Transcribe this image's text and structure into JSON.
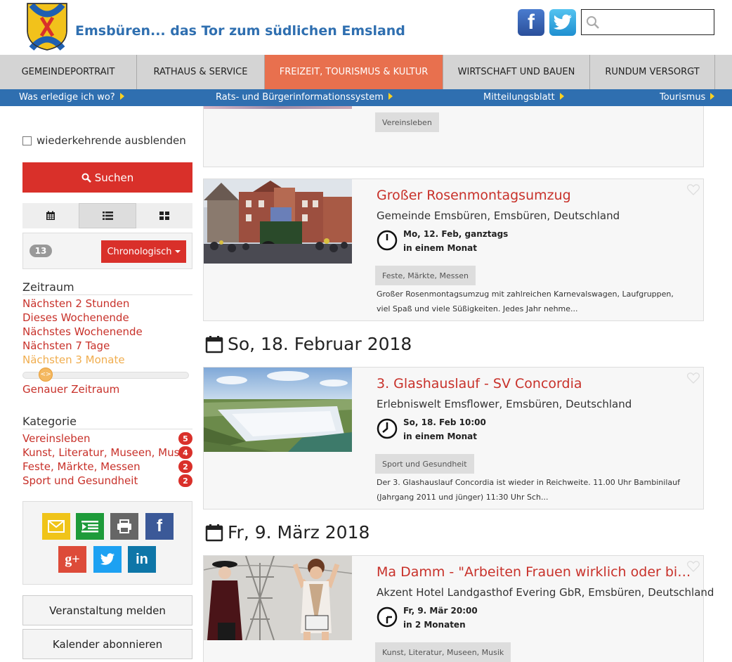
{
  "header": {
    "site_title": "Emsbüren... das Tor zum südlichen Emsland",
    "search_placeholder": ""
  },
  "main_nav": [
    "GEMEINDEPORTRAIT",
    "RATHAUS & SERVICE",
    "FREIZEIT, TOURISMUS & KULTUR",
    "WIRTSCHAFT UND BAUEN",
    "RUNDUM VERSORGT"
  ],
  "sub_nav": [
    "Was erledige ich wo?",
    "Rats- und Bürgerinformationssystem",
    "Mitteilungsblatt",
    "Tourismus"
  ],
  "sidebar": {
    "hide_recurring_label": "wiederkehrende ausblenden",
    "search_button": "Suchen",
    "result_count": "13",
    "sort_label": "Chronologisch",
    "timeframe_heading": "Zeitraum",
    "timeframe_links": [
      "Nächsten 2 Stunden",
      "Dieses Wochenende",
      "Nächstes Wochenende",
      "Nächsten 7 Tage",
      "Nächsten 3 Monate"
    ],
    "timeframe_active": "Nächsten 3 Monate",
    "exact_timeframe": "Genauer Zeitraum",
    "category_heading": "Kategorie",
    "categories": [
      {
        "name": "Vereinsleben",
        "count": "5"
      },
      {
        "name": "Kunst, Literatur, Museen, Musik",
        "count": "4"
      },
      {
        "name": "Feste, Märkte, Messen",
        "count": "2"
      },
      {
        "name": "Sport und Gesundheit",
        "count": "2"
      }
    ],
    "report_event": "Veranstaltung melden",
    "subscribe_calendar": "Kalender abonnieren"
  },
  "events": {
    "partial_tag": "Vereinsleben",
    "day1": "So, 18. Februar 2018",
    "day2": "Fr, 9. März 2018",
    "list": [
      {
        "title": "Großer Rosenmontagsumzug",
        "location": "Gemeinde Emsbüren, Emsbüren, Deutschland",
        "date": "Mo, 12. Feb, ganztags",
        "relative": "in einem Monat",
        "tag": "Feste, Märkte, Messen",
        "desc": "Großer Rosenmontagsumzug mit zahlreichen Karnevalswagen, Laufgruppen, viel Spaß und viele Süßigkeiten. Jedes Jahr nehme..."
      },
      {
        "title": "3. Glashauslauf - SV Concordia",
        "location": "Erlebniswelt Emsflower, Emsbüren, Deutschland",
        "date": "So, 18. Feb 10:00",
        "relative": "in einem Monat",
        "tag": "Sport und Gesundheit",
        "desc": "Der 3. Glashauslauf Concordia ist wieder in Reichweite. 11.00 Uhr Bambinilauf (Jahrgang 2011 und jünger) 11:30 Uhr Sch..."
      },
      {
        "title": "Ma Damm - \"Arbeiten Frauen wirklich oder bilden s...",
        "location": "Akzent Hotel Landgasthof Evering GbR, Emsbüren, Deutschland",
        "date": "Fr, 9. Mär 20:00",
        "relative": "in 2 Monaten",
        "tag": "Kunst, Literatur, Museen, Musik"
      }
    ]
  },
  "colors": {
    "accent_red": "#d9302a",
    "brand_blue": "#2f6fb0",
    "nav_active": "#e8704e",
    "link_red": "#c8312a"
  }
}
